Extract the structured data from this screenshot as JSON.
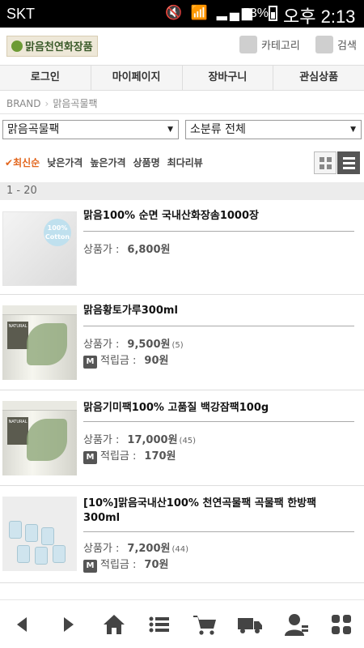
{
  "status": {
    "carrier": "SKT",
    "battery": "53%",
    "time": "오후 2:13"
  },
  "header": {
    "logo_text": "맑음천연화장품",
    "category_label": "카테고리",
    "search_label": "검색"
  },
  "nav": [
    "로그인",
    "마이페이지",
    "장바구니",
    "관심상품"
  ],
  "breadcrumb": {
    "root": "BRAND",
    "current": "맑음곡물팩"
  },
  "filters": {
    "category": "맑음곡물팩",
    "subcategory": "소분류 전체"
  },
  "sort": {
    "active": "최신순",
    "options": [
      "낮은가격",
      "높은가격",
      "상품명",
      "최다리뷰"
    ]
  },
  "range": "1 - 20",
  "labels": {
    "price": "상품가 :",
    "points": "적립금 :",
    "points_badge": "M",
    "badge_cotton": "100% Cotton"
  },
  "products": [
    {
      "name": "맑음100% 순면 국내산화장솜1000장",
      "price": "6,800원",
      "reviews": "",
      "points": ""
    },
    {
      "name": "맑음황토가루300ml",
      "price": "9,500원",
      "reviews": "(5)",
      "points": "90원"
    },
    {
      "name": "맑음기미팩100% 고품질 백강잠팩100g",
      "price": "17,000원",
      "reviews": "(45)",
      "points": "170원"
    },
    {
      "name": "[10%]맑음국내산100% 천연곡물팩 곡물팩 한방팩 300ml",
      "price": "7,200원",
      "reviews": "(44)",
      "points": "70원"
    }
  ],
  "tabbar": [
    "back-icon",
    "forward-icon",
    "home-icon",
    "menu-list-icon",
    "cart-icon",
    "delivery-truck-icon",
    "user-icon",
    "apps-grid-icon"
  ]
}
